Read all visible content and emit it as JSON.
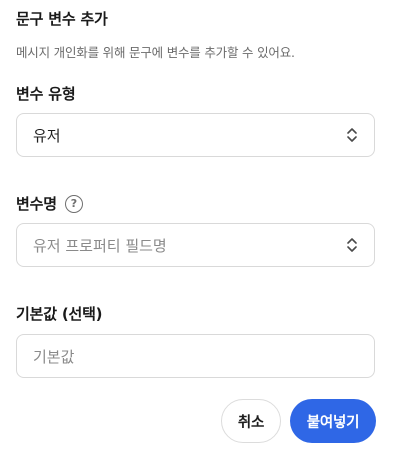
{
  "dialog": {
    "title": "문구 변수 추가",
    "description": "메시지 개인화를 위해 문구에 변수를 추가할 수 있어요."
  },
  "variable_type": {
    "label": "변수 유형",
    "selected": "유저"
  },
  "variable_name": {
    "label": "변수명",
    "help_icon": "question-circle-icon",
    "placeholder": "유저 프로퍼티 필드명"
  },
  "default_value": {
    "label": "기본값 (선택)",
    "placeholder": "기본값"
  },
  "actions": {
    "cancel": "취소",
    "paste": "붙여넣기"
  },
  "colors": {
    "primary": "#2f67e6",
    "border": "#d9d9d9"
  }
}
